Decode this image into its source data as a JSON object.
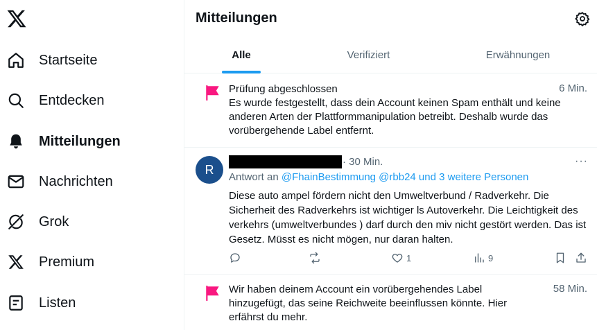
{
  "sidebar": {
    "items": [
      {
        "label": "Startseite",
        "icon": "home-icon"
      },
      {
        "label": "Entdecken",
        "icon": "search-icon"
      },
      {
        "label": "Mitteilungen",
        "icon": "bell-icon"
      },
      {
        "label": "Nachrichten",
        "icon": "mail-icon"
      },
      {
        "label": "Grok",
        "icon": "grok-icon"
      },
      {
        "label": "Premium",
        "icon": "x-icon"
      },
      {
        "label": "Listen",
        "icon": "list-icon"
      }
    ]
  },
  "header": {
    "title": "Mitteilungen"
  },
  "tabs": [
    {
      "label": "Alle"
    },
    {
      "label": "Verifiziert"
    },
    {
      "label": "Erwähnungen"
    }
  ],
  "notifications": [
    {
      "title": "Prüfung abgeschlossen",
      "body": "Es wurde festgestellt, dass dein Account keinen Spam enthält und keine anderen Arten der Plattformmanipulation betreibt. Deshalb wurde das vorübergehende Label entfernt.",
      "time": "6 Min."
    },
    {
      "title": "",
      "body": "Wir haben deinem Account ein vorübergehendes Label hinzugefügt, das seine Reichweite beeinflussen könnte. Hier erfährst du mehr.",
      "time": "58 Min."
    }
  ],
  "post": {
    "avatar_letter": "R",
    "time": "· 30 Min.",
    "more": "···",
    "reply_prefix": "Antwort an",
    "reply_targets": "@FhainBestimmung @rbb24 und 3 weitere Personen",
    "text": "Diese auto ampel fördern nicht den Umweltverbund / Radverkehr.  Die Sicherheit des Radverkehrs ist wichtiger ls Autoverkehr. Die Leichtigkeit des verkehrs (umweltverbundes ) darf durch den miv nicht gestört werden. Das ist Gesetz. Müsst es nicht mögen, nur daran halten.",
    "likes": "1",
    "views": "9"
  },
  "colors": {
    "accent": "#1d9bf0",
    "flag": "#f91880",
    "avatar": "#1b4f8c",
    "muted": "#536471"
  }
}
